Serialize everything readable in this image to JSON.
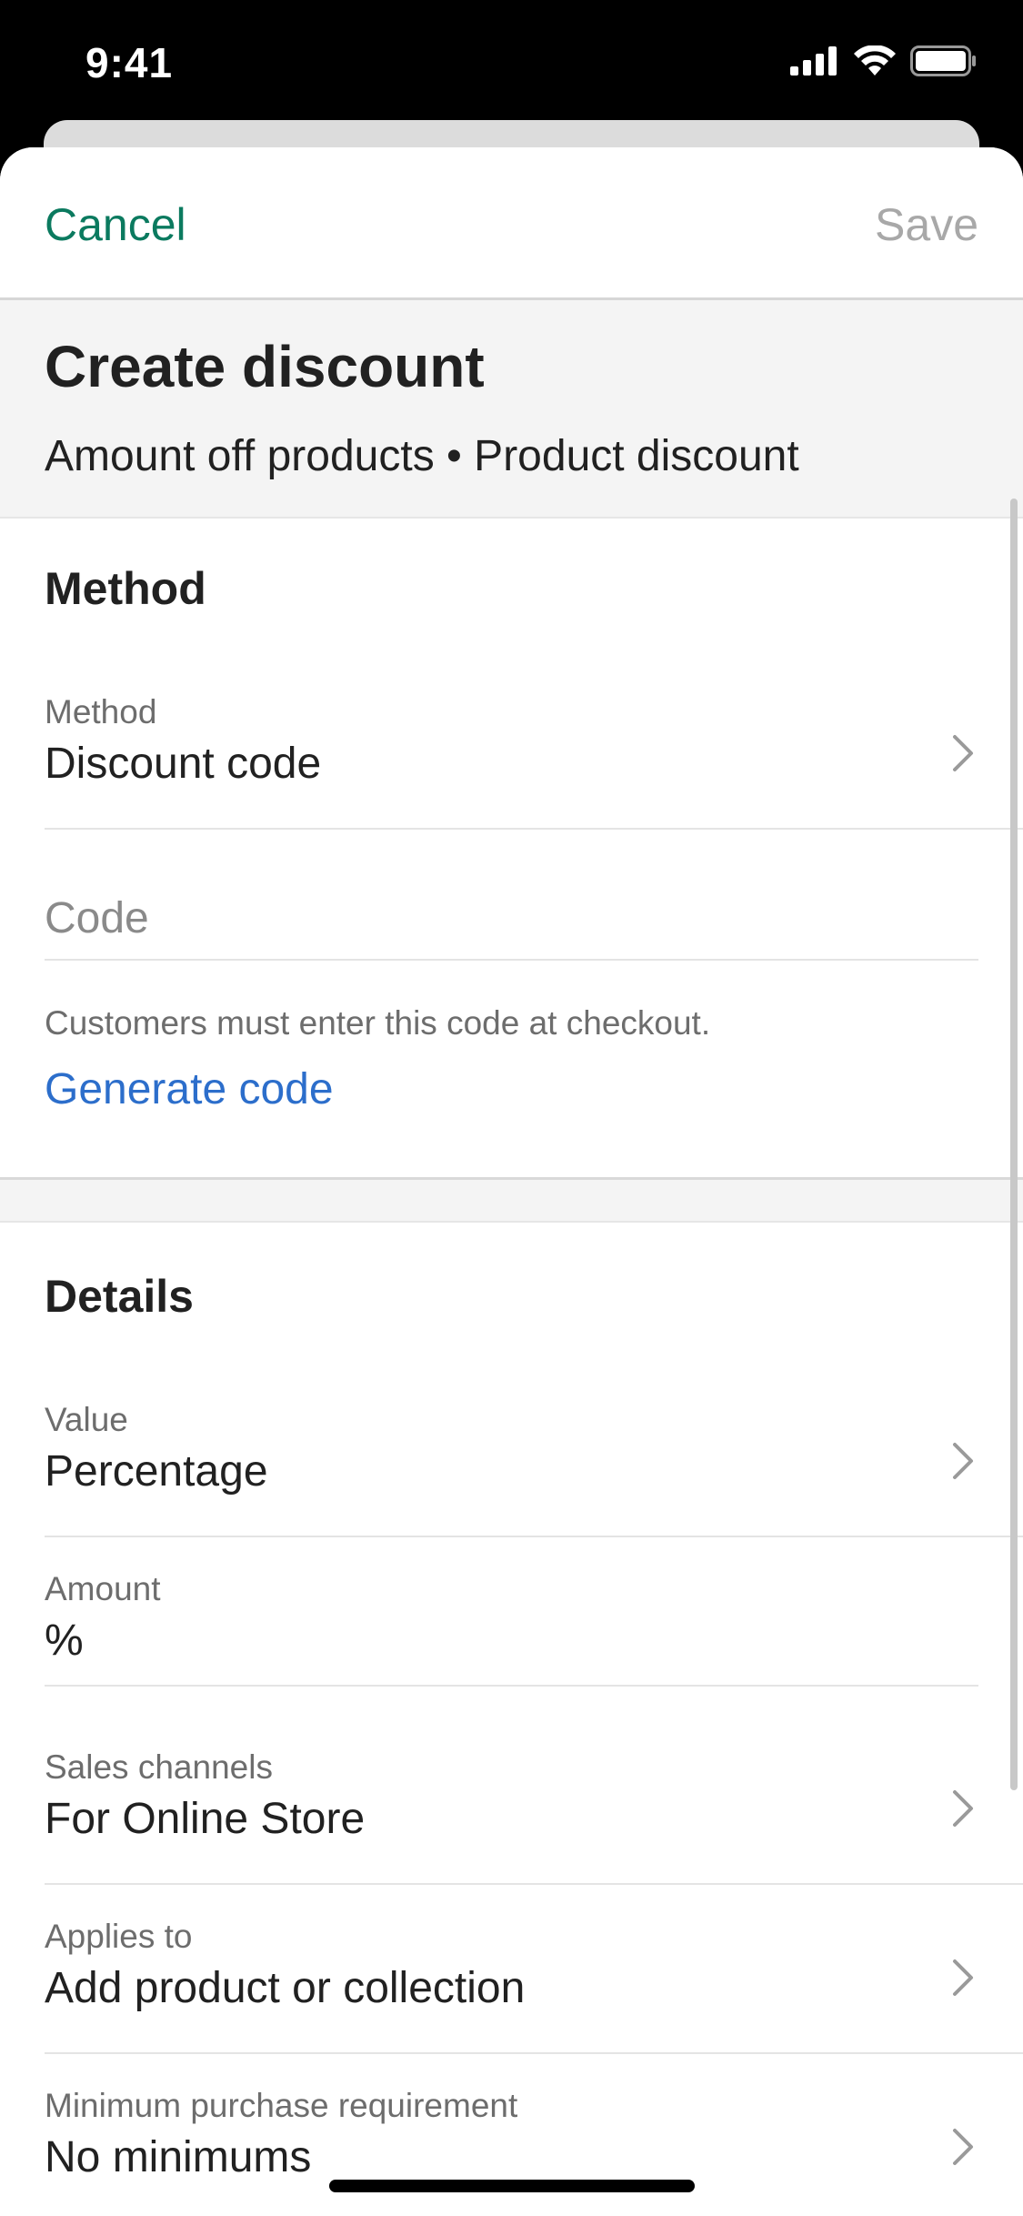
{
  "status_bar": {
    "time": "9:41",
    "icons": [
      "signal-icon",
      "wifi-icon",
      "battery-icon"
    ]
  },
  "nav": {
    "cancel_label": "Cancel",
    "save_label": "Save"
  },
  "header": {
    "title": "Create discount",
    "subtitle": "Amount off products • Product discount"
  },
  "method_section": {
    "title": "Method",
    "method_row": {
      "label": "Method",
      "value": "Discount code"
    },
    "code_placeholder": "Code",
    "help_text": "Customers must enter this code at checkout.",
    "generate_label": "Generate code"
  },
  "details_section": {
    "title": "Details",
    "rows": [
      {
        "label": "Value",
        "value": "Percentage",
        "chevron": true
      },
      {
        "label": "Amount",
        "value": "%",
        "chevron": false
      },
      {
        "label": "Sales channels",
        "value": "For Online Store",
        "chevron": true
      },
      {
        "label": "Applies to",
        "value": "Add product or collection",
        "chevron": true
      },
      {
        "label": "Minimum purchase requirement",
        "value": "No minimums",
        "chevron": true
      }
    ]
  },
  "colors": {
    "accent_green": "#0b7a5f",
    "link_blue": "#2c6ecb",
    "disabled_gray": "#a8a8a8",
    "text_dark": "#212121"
  }
}
